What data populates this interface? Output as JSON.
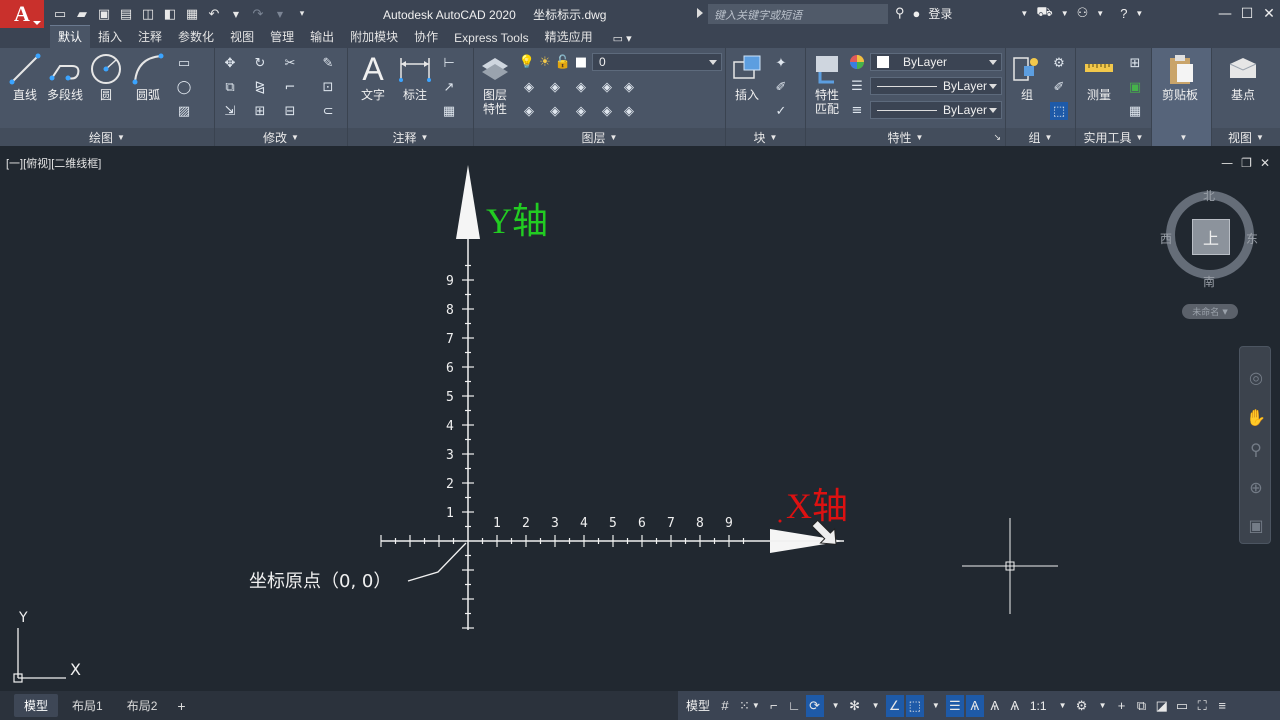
{
  "window": {
    "app_name": "Autodesk AutoCAD 2020",
    "file_name": "坐标标示.dwg",
    "search_placeholder": "键入关键字或短语",
    "login_label": "登录",
    "logo_letter": "A"
  },
  "ribbon_tabs": [
    "默认",
    "插入",
    "注释",
    "参数化",
    "视图",
    "管理",
    "输出",
    "附加模块",
    "协作",
    "Express Tools",
    "精选应用"
  ],
  "ribbon": {
    "draw": {
      "title": "绘图",
      "line": "直线",
      "polyline": "多段线",
      "circle": "圆",
      "arc": "圆弧"
    },
    "modify": {
      "title": "修改"
    },
    "annotation": {
      "title": "注释",
      "text": "文字",
      "dimension": "标注"
    },
    "layers": {
      "title": "图层",
      "layer_properties": "图层\n特性",
      "current_layer": "0"
    },
    "block": {
      "title": "块",
      "insert": "插入"
    },
    "properties": {
      "title": "特性",
      "match": "特性\n匹配",
      "color": "ByLayer",
      "linetype": "ByLayer",
      "lineweight": "ByLayer"
    },
    "groups": {
      "title": "组",
      "group": "组"
    },
    "utilities": {
      "title": "实用工具",
      "measure": "测量"
    },
    "clipboard": {
      "title": "",
      "paste": "剪贴板"
    },
    "view": {
      "title": "视图",
      "base": "基点"
    }
  },
  "viewport": {
    "label": "[一][俯视][二维线框]"
  },
  "drawing": {
    "y_axis_label": "Y轴",
    "x_axis_label": "X轴",
    "origin_label": "坐标原点（0, 0）",
    "y_ticks": [
      "1",
      "2",
      "3",
      "4",
      "5",
      "6",
      "7",
      "8",
      "9"
    ],
    "x_ticks": [
      "1",
      "2",
      "3",
      "4",
      "5",
      "6",
      "7",
      "8",
      "9"
    ],
    "ucs_x": "X",
    "ucs_y": "Y",
    "colors": {
      "y_label": "#22cc22",
      "x_label": "#dd1111",
      "lines": "#f0f0f0",
      "background": "#212830"
    }
  },
  "viewcube": {
    "north": "北",
    "south": "南",
    "east": "东",
    "west": "西",
    "face": "上",
    "wcs": "未命名"
  },
  "layout_tabs": [
    "模型",
    "布局1",
    "布局2"
  ],
  "statusbar": {
    "model_label": "模型",
    "scale_label": "1:1"
  }
}
